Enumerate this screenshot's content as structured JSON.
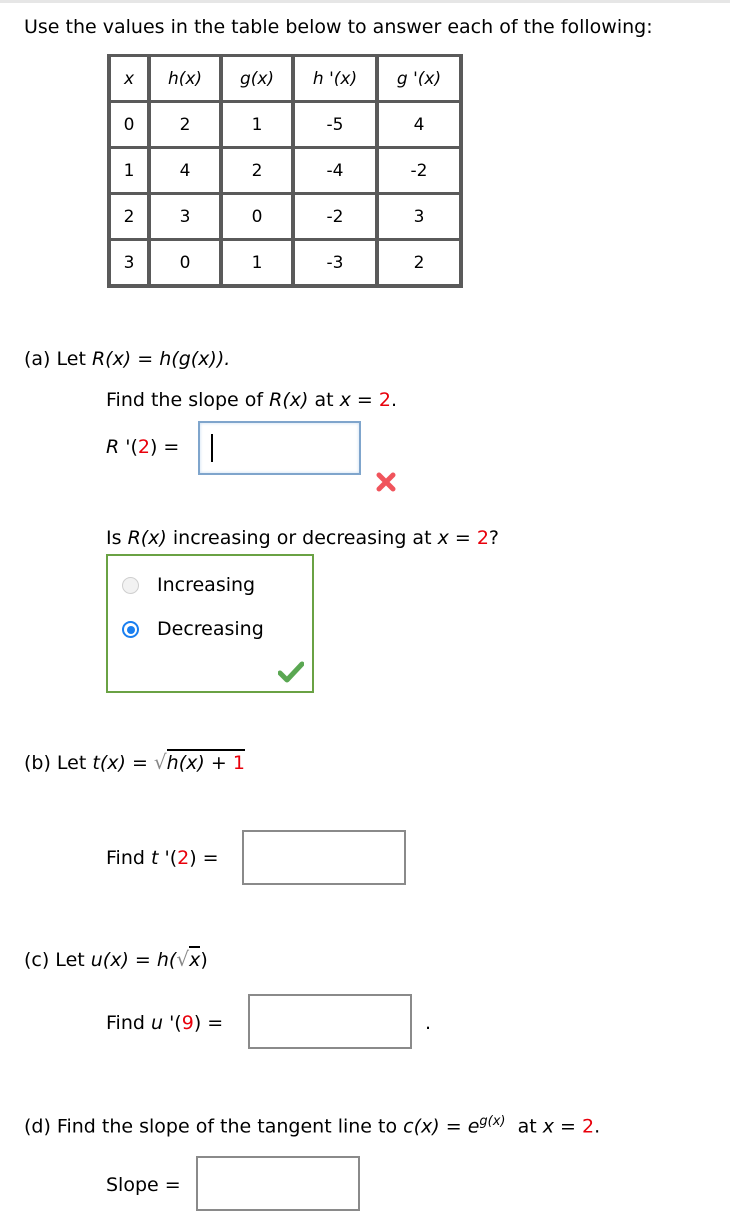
{
  "intro": "Use the values in the table below to answer each of the following:",
  "table": {
    "headers": [
      "x",
      "h(x)",
      "g(x)",
      "h '(x)",
      "g '(x)"
    ],
    "rows": [
      [
        "0",
        "2",
        "1",
        "-5",
        "4"
      ],
      [
        "1",
        "4",
        "2",
        "-4",
        "-2"
      ],
      [
        "2",
        "3",
        "0",
        "-2",
        "3"
      ],
      [
        "3",
        "0",
        "1",
        "-3",
        "2"
      ]
    ]
  },
  "part_a": {
    "label": "(a) Let",
    "func_lhs": "R(x)",
    "eq": "=",
    "func_rhs": "h(g(x)).",
    "prompt_pre": "Find the slope of",
    "prompt_func": "R(x)",
    "prompt_at": "at",
    "prompt_var": "x",
    "prompt_eq": "=",
    "prompt_val": "2",
    "prompt_end": ".",
    "answer_label_fn": "R",
    "answer_label_prime": " '(",
    "answer_label_val": "2",
    "answer_label_end": ") =",
    "answer_value": "",
    "status": "incorrect",
    "q2_pre": "Is",
    "q2_func": "R(x)",
    "q2_mid": "increasing or decreasing at",
    "q2_var": "x",
    "q2_eq": "=",
    "q2_val": "2",
    "q2_end": "?",
    "options": [
      {
        "label": "Increasing",
        "selected": false
      },
      {
        "label": "Decreasing",
        "selected": true
      }
    ],
    "mc_status": "correct"
  },
  "part_b": {
    "label": "(b) Let",
    "func_lhs": "t(x)",
    "eq": "=",
    "radicand_fn": "h(x)",
    "radicand_plus": "+",
    "radicand_const": "1",
    "prompt_pre": "Find",
    "prompt_fn": "t",
    "prompt_prime": " '(",
    "prompt_val": "2",
    "prompt_end": ") =",
    "answer_value": ""
  },
  "part_c": {
    "label": "(c) Let",
    "func_lhs": "u(x)",
    "eq": "=",
    "outer_fn": "h(",
    "radicand": "x",
    "close": ")",
    "prompt_pre": "Find",
    "prompt_fn": "u",
    "prompt_prime": " '(",
    "prompt_val": "9",
    "prompt_end": ") =",
    "answer_value": "",
    "trailing": "."
  },
  "part_d": {
    "label": "(d) Find the slope of the tangent line to",
    "func_lhs": "c(x)",
    "eq": "=",
    "base": "e",
    "exponent": "g(x)",
    "at": "at",
    "var": "x",
    "eq2": "=",
    "val": "2",
    "end": ".",
    "answer_label": "Slope =",
    "answer_value": ""
  }
}
